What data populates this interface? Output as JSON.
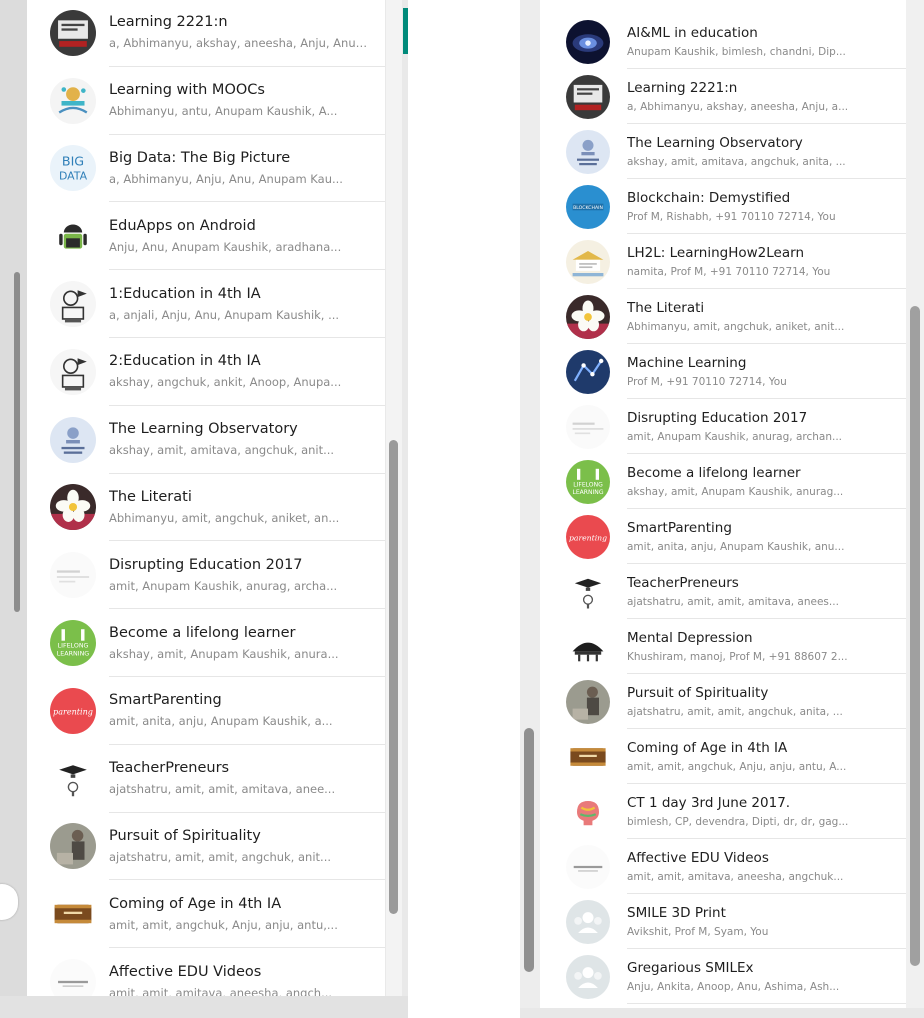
{
  "left_chats": [
    {
      "name": "Learning 2221:n",
      "members": "a, Abhimanyu, akshay, aneesha, Anju, Anupam Kaushik, anurag, ...",
      "avatar": "learning-2221-avatar-icon"
    },
    {
      "name": "Learning with MOOCs",
      "members": "Abhimanyu, antu, Anupam Kaushik, A...",
      "avatar": "mooc-avatar-icon"
    },
    {
      "name": "Big Data: The Big Picture",
      "members": "a, Abhimanyu, Anju, Anu, Anupam Kau...",
      "avatar": "big-data-avatar-icon"
    },
    {
      "name": "EduApps on Android",
      "members": "Anju, Anu, Anupam Kaushik, aradhana...",
      "avatar": "android-avatar-icon"
    },
    {
      "name": "1:Education in 4th IA",
      "members": "a, anjali, Anju, Anu, Anupam Kaushik, ...",
      "avatar": "education-sketch-avatar-icon"
    },
    {
      "name": "2:Education in 4th IA",
      "members": "akshay, angchuk, ankit, Anoop, Anupa...",
      "avatar": "education-sketch-avatar-icon"
    },
    {
      "name": "The Learning Observatory",
      "members": "akshay, amit, amitava, angchuk, anit...",
      "avatar": "lifelong-learner-avatar-icon"
    },
    {
      "name": "The Literati",
      "members": "Abhimanyu, amit, angchuk, aniket, an...",
      "avatar": "flower-avatar-icon"
    },
    {
      "name": "Disrupting Education 2017",
      "members": "amit, Anupam Kaushik, anurag, archa...",
      "avatar": "disrupting-avatar-icon"
    },
    {
      "name": "Become a lifelong learner",
      "members": "akshay, amit, Anupam Kaushik, anura...",
      "avatar": "lifelong-green-avatar-icon"
    },
    {
      "name": "SmartParenting",
      "members": "amit, anita, anju, Anupam Kaushik, a...",
      "avatar": "parenting-avatar-icon"
    },
    {
      "name": "TeacherPreneurs",
      "members": "ajatshatru, amit, amit, amitava, anee...",
      "avatar": "teacherpreneur-avatar-icon"
    },
    {
      "name": "Pursuit of Spirituality",
      "members": "ajatshatru, amit, amit, angchuk, anit...",
      "avatar": "spirituality-avatar-icon"
    },
    {
      "name": "Coming of Age in 4th IA",
      "members": "amit, amit, angchuk, Anju, anju, antu,...",
      "avatar": "coming-of-age-avatar-icon"
    },
    {
      "name": "Affective EDU Videos",
      "members": "amit, amit, amitava, aneesha, angch...",
      "avatar": "affective-avatar-icon"
    }
  ],
  "right_chats": [
    {
      "name": "AI&ML in education",
      "members": "Anupam Kaushik, bimlesh, chandni, Dip...",
      "avatar": "ai-ml-avatar-icon"
    },
    {
      "name": "Learning 2221:n",
      "members": "a, Abhimanyu, akshay, aneesha, Anju, a...",
      "avatar": "learning-2221-avatar-icon"
    },
    {
      "name": "The Learning Observatory",
      "members": "akshay, amit, amitava, angchuk, anita, ...",
      "avatar": "lifelong-learner-avatar-icon"
    },
    {
      "name": "Blockchain: Demystified",
      "members": "Prof M, Rishabh, +91 70110 72714, You",
      "avatar": "blockchain-avatar-icon"
    },
    {
      "name": "LH2L: LearningHow2Learn",
      "members": "namita, Prof M, +91 70110 72714, You",
      "avatar": "lh2l-avatar-icon"
    },
    {
      "name": "The Literati",
      "members": "Abhimanyu, amit, angchuk, aniket, anit...",
      "avatar": "flower-avatar-icon"
    },
    {
      "name": "Machine Learning",
      "members": "Prof M, +91 70110 72714, You",
      "avatar": "machine-learning-avatar-icon"
    },
    {
      "name": "Disrupting Education 2017",
      "members": "amit, Anupam Kaushik, anurag, archan...",
      "avatar": "disrupting-avatar-icon"
    },
    {
      "name": "Become a lifelong learner",
      "members": "akshay, amit, Anupam Kaushik, anurag...",
      "avatar": "lifelong-green-avatar-icon"
    },
    {
      "name": "SmartParenting",
      "members": "amit, anita, anju, Anupam Kaushik, anu...",
      "avatar": "parenting-avatar-icon"
    },
    {
      "name": "TeacherPreneurs",
      "members": "ajatshatru, amit, amit, amitava, anees...",
      "avatar": "teacherpreneur-avatar-icon"
    },
    {
      "name": "Mental Depression",
      "members": "Khushiram, manoj, Prof M, +91 88607 2...",
      "avatar": "mental-depression-avatar-icon"
    },
    {
      "name": "Pursuit of Spirituality",
      "members": "ajatshatru, amit, amit, angchuk, anita, ...",
      "avatar": "spirituality-avatar-icon"
    },
    {
      "name": "Coming of Age in 4th IA",
      "members": "amit, amit, angchuk, Anju, anju, antu, A...",
      "avatar": "coming-of-age-avatar-icon"
    },
    {
      "name": "CT 1 day 3rd June 2017.",
      "members": "bimlesh, CP, devendra, Dipti, dr, dr, gag...",
      "avatar": "ct-brain-avatar-icon"
    },
    {
      "name": "Affective EDU Videos",
      "members": "amit, amit, amitava, aneesha, angchuk...",
      "avatar": "affective-avatar-icon"
    },
    {
      "name": "SMILE 3D Print",
      "members": "Avikshit, Prof M, Syam, You",
      "avatar": "default-group-avatar-icon"
    },
    {
      "name": "Gregarious SMILEx",
      "members": "Anju, Ankita, Anoop, Anu, Ashima, Ash...",
      "avatar": "default-group-avatar-icon"
    }
  ],
  "avatar_text": {
    "big_data": [
      "BIG",
      "DATA"
    ],
    "parenting": "parenting",
    "lifelong": [
      "LIFELONG",
      "LEARNING"
    ],
    "blockchain": "BLOCKCHAIN"
  },
  "colors": {
    "teal_accent": "#008a7a",
    "divider": "#e6e6e6",
    "name_text": "#1e1e1e",
    "member_text": "#8a8a8a"
  }
}
